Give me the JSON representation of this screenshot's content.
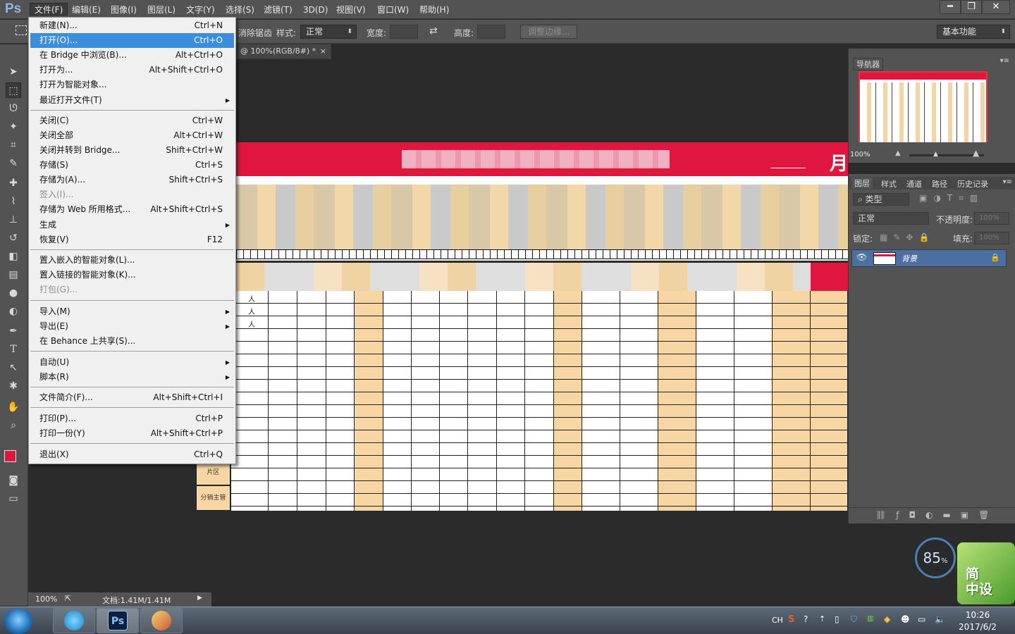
{
  "app": {
    "logo": "Ps",
    "menus": [
      "文件(F)",
      "编辑(E)",
      "图像(I)",
      "图层(L)",
      "文字(Y)",
      "选择(S)",
      "滤镜(T)",
      "3D(D)",
      "视图(V)",
      "窗口(W)",
      "帮助(H)"
    ],
    "window_buttons": [
      "━",
      "❐",
      "✕"
    ]
  },
  "options": {
    "anti_alias_label": "消除锯齿",
    "style_label": "样式:",
    "style_value": "正常",
    "width_label": "宽度:",
    "height_label": "高度:",
    "refine_edge": "调整边缘...",
    "workspace": "基本功能"
  },
  "document": {
    "tab_title": "@ 100%(RGB/8#) *",
    "tab_close": "×",
    "month_label": "月",
    "person_marks": [
      "人",
      "人",
      "人"
    ],
    "row_labels": [
      "片区",
      "分销主管"
    ]
  },
  "file_menu": {
    "items": [
      {
        "label": "新建(N)...",
        "shortcut": "Ctrl+N"
      },
      {
        "label": "打开(O)...",
        "shortcut": "Ctrl+O"
      },
      {
        "label": "在 Bridge 中浏览(B)...",
        "shortcut": "Alt+Ctrl+O"
      },
      {
        "label": "打开为...",
        "shortcut": "Alt+Shift+Ctrl+O"
      },
      {
        "label": "打开为智能对象...",
        "shortcut": ""
      },
      {
        "label": "最近打开文件(T)",
        "shortcut": ""
      },
      {
        "label": "关闭(C)",
        "shortcut": "Ctrl+W"
      },
      {
        "label": "关闭全部",
        "shortcut": "Alt+Ctrl+W"
      },
      {
        "label": "关闭并转到 Bridge...",
        "shortcut": "Shift+Ctrl+W"
      },
      {
        "label": "存储(S)",
        "shortcut": "Ctrl+S"
      },
      {
        "label": "存储为(A)...",
        "shortcut": "Shift+Ctrl+S"
      },
      {
        "label": "签入(I)...",
        "shortcut": ""
      },
      {
        "label": "存储为 Web 所用格式...",
        "shortcut": "Alt+Shift+Ctrl+S"
      },
      {
        "label": "生成",
        "shortcut": ""
      },
      {
        "label": "恢复(V)",
        "shortcut": "F12"
      },
      {
        "label": "置入嵌入的智能对象(L)...",
        "shortcut": ""
      },
      {
        "label": "置入链接的智能对象(K)...",
        "shortcut": ""
      },
      {
        "label": "打包(G)...",
        "shortcut": ""
      },
      {
        "label": "导入(M)",
        "shortcut": ""
      },
      {
        "label": "导出(E)",
        "shortcut": ""
      },
      {
        "label": "在 Behance 上共享(S)...",
        "shortcut": ""
      },
      {
        "label": "自动(U)",
        "shortcut": ""
      },
      {
        "label": "脚本(R)",
        "shortcut": ""
      },
      {
        "label": "文件简介(F)...",
        "shortcut": "Alt+Shift+Ctrl+I"
      },
      {
        "label": "打印(P)...",
        "shortcut": "Ctrl+P"
      },
      {
        "label": "打印一份(Y)",
        "shortcut": "Alt+Shift+Ctrl+P"
      },
      {
        "label": "退出(X)",
        "shortcut": "Ctrl+Q"
      }
    ],
    "submenu_arrow": "▶"
  },
  "navigator": {
    "tab": "导航器",
    "zoom": "100%"
  },
  "layers": {
    "tabs": [
      "图层",
      "样式",
      "通道",
      "路径",
      "历史记录"
    ],
    "filter_kind": "类型",
    "blend_mode": "正常",
    "opacity_label": "不透明度:",
    "opacity_value": "100%",
    "lock_label": "锁定:",
    "fill_label": "填充:",
    "fill_value": "100%",
    "layer_name": "背景"
  },
  "status": {
    "zoom": "100%",
    "doc_size": "文档:1.41M/1.41M"
  },
  "widget": {
    "percent": "85",
    "percent_unit": "%",
    "brand": "简\n中设"
  },
  "taskbar": {
    "ime": "CH",
    "time": "10:26",
    "date": "2017/6/2",
    "ps_label": "Ps"
  },
  "colors": {
    "accent_red": "#e0163f",
    "peach": "#f7d6a3",
    "menu_highlight": "#3b8ede"
  }
}
